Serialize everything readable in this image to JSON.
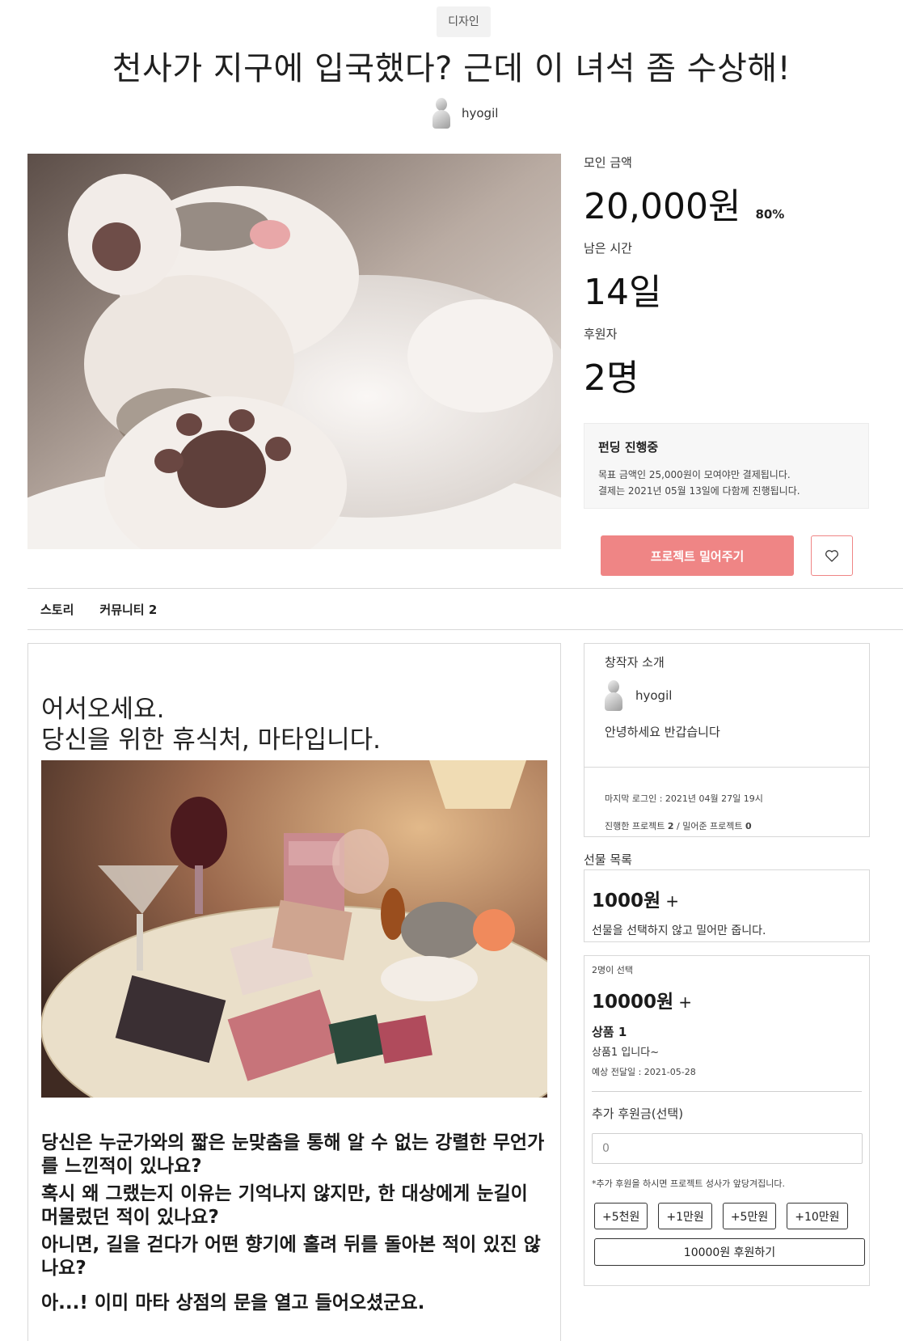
{
  "category": "디자인",
  "title": "천사가 지구에 입국했다? 근데 이 녀석 좀 수상해!",
  "author": "hyogil",
  "stats": {
    "raised_label": "모인 금액",
    "raised_value": "20,000원",
    "raised_percent": "80%",
    "time_label": "남은 시간",
    "time_value": "14일",
    "backers_label": "후원자",
    "backers_value": "2명"
  },
  "funding_box": {
    "title": "펀딩 진행중",
    "line1": "목표 금액인 25,000원이 모여야만 결제됩니다.",
    "line2": "결제는 2021년 05월 13일에 다함께 진행됩니다."
  },
  "push_button_label": "프로젝트 밀어주기",
  "tabs": [
    "스토리",
    "커뮤니티 2"
  ],
  "story": {
    "heading_line1": "어서오세요.",
    "heading_line2": "당신을 위한 휴식처, 마타입니다.",
    "paragraphs": [
      "당신은 누군가와의 짧은 눈맞춤을 통해 알 수 없는 강렬한 무언가를 느낀적이 있나요?",
      "혹시 왜 그랬는지 이유는 기억나지 않지만, 한 대상에게 눈길이 머물렀던 적이 있나요?",
      "아니면, 길을 걷다가 어떤 향기에 홀려 뒤를 돌아본 적이 있진 않나요?",
      "아...! 이미 마타 상점의 문을 열고 들어오셨군요."
    ]
  },
  "creator": {
    "title": "창작자 소개",
    "name": "hyogil",
    "greeting": "안녕하세요 반갑습니다",
    "last_login_label": "마지막 로그인 : 2021년 04월 27일 19시",
    "projects_made_label": "진행한 프로젝트",
    "projects_made": "2",
    "projects_backed_label": "/ 밀어준 프로젝트",
    "projects_backed": "0"
  },
  "gifts": {
    "title": "선물 목록",
    "gift1": {
      "price": "1000원",
      "plus": "+",
      "desc": "선물을 선택하지 않고 밀어만 줍니다."
    },
    "gift2": {
      "count": "2명이 선택",
      "price": "10000원",
      "plus": "+",
      "item": "상품 1",
      "item_desc": "상품1 입니다~",
      "delivery": "예상 전달일 : 2021-05-28",
      "extra_label": "추가 후원금(선택)",
      "extra_placeholder": "0",
      "note": "*추가 후원을 하시면 프로젝트 성사가 앞당겨집니다.",
      "chips": [
        "+5천원",
        "+1만원",
        "+5만원",
        "+10만원"
      ],
      "submit_label": "10000원 후원하기"
    }
  },
  "colors": {
    "accent": "#ef8585"
  }
}
